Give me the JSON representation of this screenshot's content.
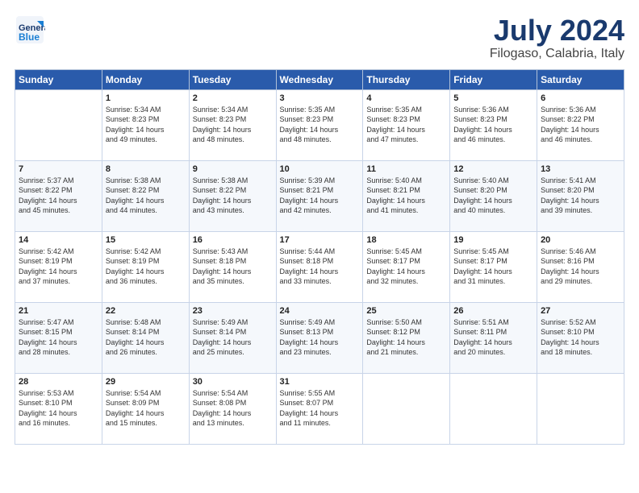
{
  "header": {
    "logo_line1": "General",
    "logo_line2": "Blue",
    "main_title": "July 2024",
    "sub_title": "Filogaso, Calabria, Italy"
  },
  "weekdays": [
    "Sunday",
    "Monday",
    "Tuesday",
    "Wednesday",
    "Thursday",
    "Friday",
    "Saturday"
  ],
  "weeks": [
    [
      {
        "day": "",
        "info": ""
      },
      {
        "day": "1",
        "info": "Sunrise: 5:34 AM\nSunset: 8:23 PM\nDaylight: 14 hours\nand 49 minutes."
      },
      {
        "day": "2",
        "info": "Sunrise: 5:34 AM\nSunset: 8:23 PM\nDaylight: 14 hours\nand 48 minutes."
      },
      {
        "day": "3",
        "info": "Sunrise: 5:35 AM\nSunset: 8:23 PM\nDaylight: 14 hours\nand 48 minutes."
      },
      {
        "day": "4",
        "info": "Sunrise: 5:35 AM\nSunset: 8:23 PM\nDaylight: 14 hours\nand 47 minutes."
      },
      {
        "day": "5",
        "info": "Sunrise: 5:36 AM\nSunset: 8:23 PM\nDaylight: 14 hours\nand 46 minutes."
      },
      {
        "day": "6",
        "info": "Sunrise: 5:36 AM\nSunset: 8:22 PM\nDaylight: 14 hours\nand 46 minutes."
      }
    ],
    [
      {
        "day": "7",
        "info": "Sunrise: 5:37 AM\nSunset: 8:22 PM\nDaylight: 14 hours\nand 45 minutes."
      },
      {
        "day": "8",
        "info": "Sunrise: 5:38 AM\nSunset: 8:22 PM\nDaylight: 14 hours\nand 44 minutes."
      },
      {
        "day": "9",
        "info": "Sunrise: 5:38 AM\nSunset: 8:22 PM\nDaylight: 14 hours\nand 43 minutes."
      },
      {
        "day": "10",
        "info": "Sunrise: 5:39 AM\nSunset: 8:21 PM\nDaylight: 14 hours\nand 42 minutes."
      },
      {
        "day": "11",
        "info": "Sunrise: 5:40 AM\nSunset: 8:21 PM\nDaylight: 14 hours\nand 41 minutes."
      },
      {
        "day": "12",
        "info": "Sunrise: 5:40 AM\nSunset: 8:20 PM\nDaylight: 14 hours\nand 40 minutes."
      },
      {
        "day": "13",
        "info": "Sunrise: 5:41 AM\nSunset: 8:20 PM\nDaylight: 14 hours\nand 39 minutes."
      }
    ],
    [
      {
        "day": "14",
        "info": "Sunrise: 5:42 AM\nSunset: 8:19 PM\nDaylight: 14 hours\nand 37 minutes."
      },
      {
        "day": "15",
        "info": "Sunrise: 5:42 AM\nSunset: 8:19 PM\nDaylight: 14 hours\nand 36 minutes."
      },
      {
        "day": "16",
        "info": "Sunrise: 5:43 AM\nSunset: 8:18 PM\nDaylight: 14 hours\nand 35 minutes."
      },
      {
        "day": "17",
        "info": "Sunrise: 5:44 AM\nSunset: 8:18 PM\nDaylight: 14 hours\nand 33 minutes."
      },
      {
        "day": "18",
        "info": "Sunrise: 5:45 AM\nSunset: 8:17 PM\nDaylight: 14 hours\nand 32 minutes."
      },
      {
        "day": "19",
        "info": "Sunrise: 5:45 AM\nSunset: 8:17 PM\nDaylight: 14 hours\nand 31 minutes."
      },
      {
        "day": "20",
        "info": "Sunrise: 5:46 AM\nSunset: 8:16 PM\nDaylight: 14 hours\nand 29 minutes."
      }
    ],
    [
      {
        "day": "21",
        "info": "Sunrise: 5:47 AM\nSunset: 8:15 PM\nDaylight: 14 hours\nand 28 minutes."
      },
      {
        "day": "22",
        "info": "Sunrise: 5:48 AM\nSunset: 8:14 PM\nDaylight: 14 hours\nand 26 minutes."
      },
      {
        "day": "23",
        "info": "Sunrise: 5:49 AM\nSunset: 8:14 PM\nDaylight: 14 hours\nand 25 minutes."
      },
      {
        "day": "24",
        "info": "Sunrise: 5:49 AM\nSunset: 8:13 PM\nDaylight: 14 hours\nand 23 minutes."
      },
      {
        "day": "25",
        "info": "Sunrise: 5:50 AM\nSunset: 8:12 PM\nDaylight: 14 hours\nand 21 minutes."
      },
      {
        "day": "26",
        "info": "Sunrise: 5:51 AM\nSunset: 8:11 PM\nDaylight: 14 hours\nand 20 minutes."
      },
      {
        "day": "27",
        "info": "Sunrise: 5:52 AM\nSunset: 8:10 PM\nDaylight: 14 hours\nand 18 minutes."
      }
    ],
    [
      {
        "day": "28",
        "info": "Sunrise: 5:53 AM\nSunset: 8:10 PM\nDaylight: 14 hours\nand 16 minutes."
      },
      {
        "day": "29",
        "info": "Sunrise: 5:54 AM\nSunset: 8:09 PM\nDaylight: 14 hours\nand 15 minutes."
      },
      {
        "day": "30",
        "info": "Sunrise: 5:54 AM\nSunset: 8:08 PM\nDaylight: 14 hours\nand 13 minutes."
      },
      {
        "day": "31",
        "info": "Sunrise: 5:55 AM\nSunset: 8:07 PM\nDaylight: 14 hours\nand 11 minutes."
      },
      {
        "day": "",
        "info": ""
      },
      {
        "day": "",
        "info": ""
      },
      {
        "day": "",
        "info": ""
      }
    ]
  ]
}
